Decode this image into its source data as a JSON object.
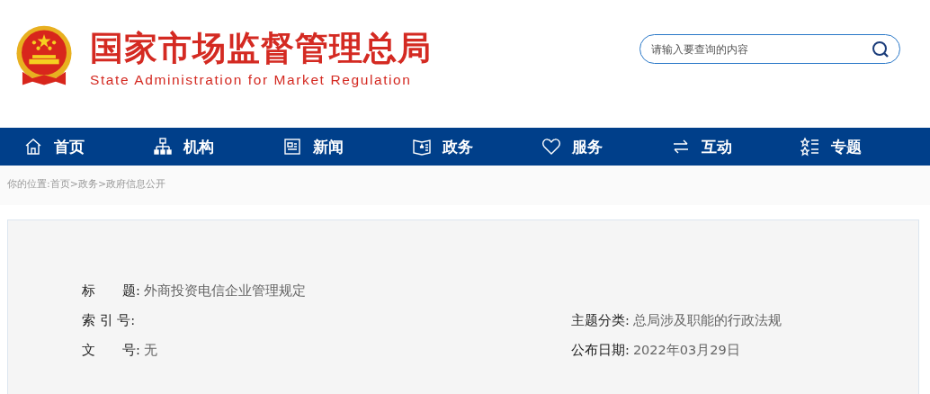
{
  "header": {
    "title": "国家市场监督管理总局",
    "subtitle": "State Administration for Market Regulation"
  },
  "search": {
    "placeholder": "请输入要查询的内容"
  },
  "nav": [
    {
      "label": "首页"
    },
    {
      "label": "机构"
    },
    {
      "label": "新闻"
    },
    {
      "label": "政务"
    },
    {
      "label": "服务"
    },
    {
      "label": "互动"
    },
    {
      "label": "专题"
    }
  ],
  "breadcrumb": {
    "label": "你的位置:",
    "links": [
      "首页",
      "政务",
      "政府信息公开"
    ],
    "separator": ">"
  },
  "info": [
    [
      {
        "label": "标　　题:",
        "value": "外商投资电信企业管理规定"
      }
    ],
    [
      {
        "label": "索 引 号:"
      },
      {
        "label": "主题分类:",
        "value": "总局涉及职能的行政法规"
      }
    ],
    [
      {
        "label": "文　　号:",
        "value": "无"
      },
      {
        "label": "公布日期:",
        "value": "2022年03月29日"
      }
    ]
  ]
}
